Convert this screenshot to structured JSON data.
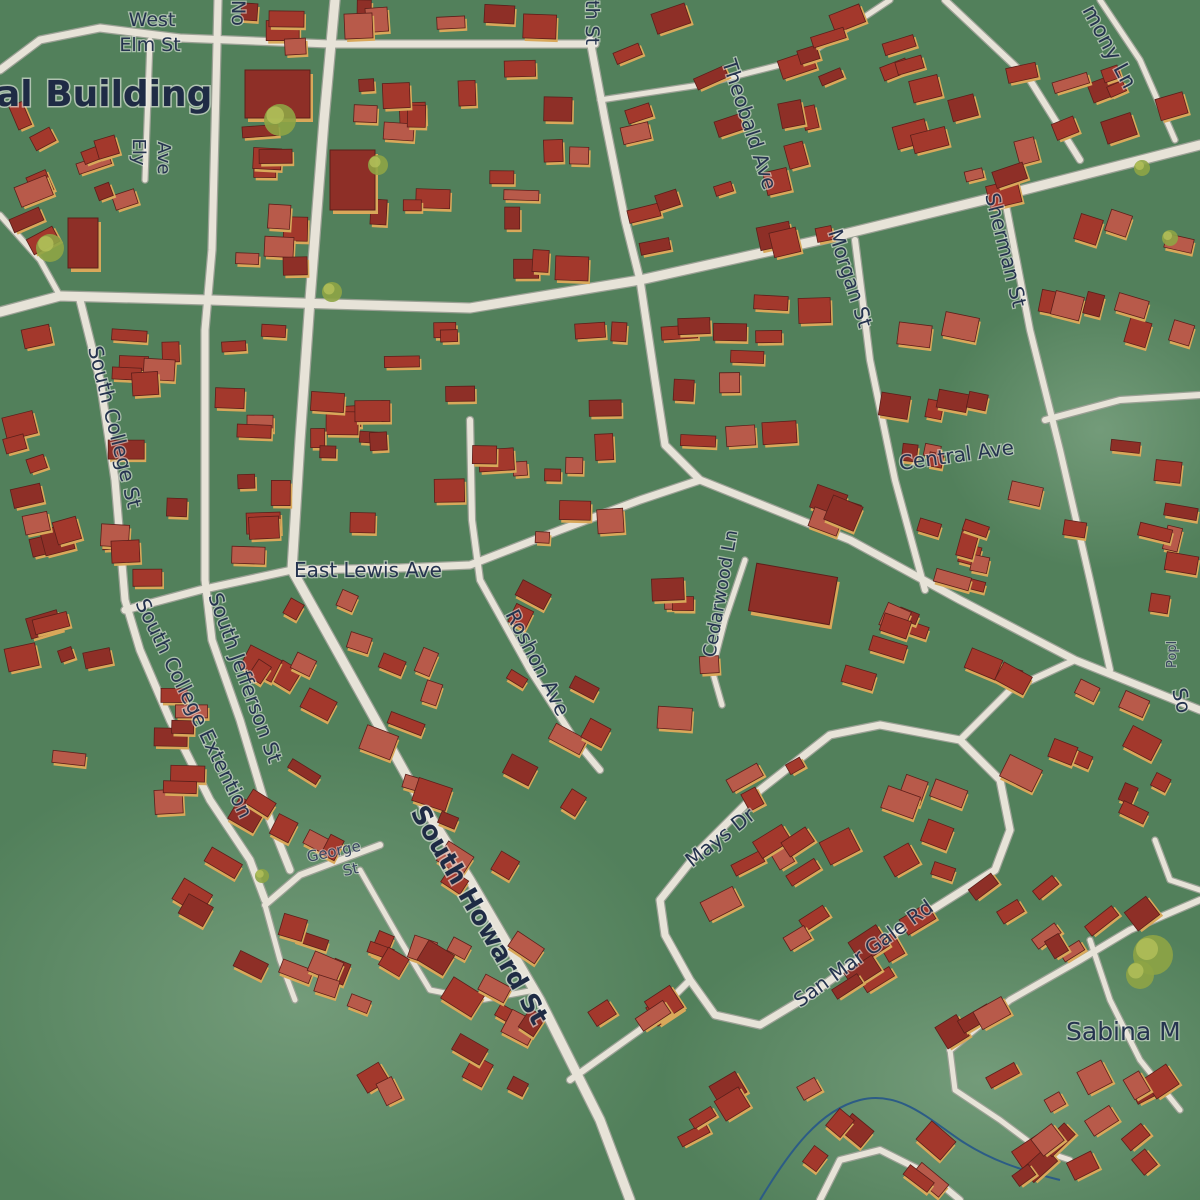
{
  "map": {
    "colors": {
      "ground": "#52805b",
      "ground_light": "#6f9a75",
      "road": "#e7e3d8",
      "road_edge": "#9aa094",
      "roof_dark": "#8e2f27",
      "roof": "#a3382c",
      "roof_light": "#b85a4a",
      "wall": "#d9a85a",
      "tree": "#8ea445",
      "stream": "#2c5c86",
      "label": "#25334f"
    },
    "labels": {
      "west_elm_st_1": "West",
      "west_elm_st_2": "Elm St",
      "municipal_building": "al Building",
      "ely_ave_1": "Ely",
      "ely_ave_2": "Ave",
      "north_st_partial": "No",
      "south_st_partial": "th St",
      "harmony_ln": "mony Ln",
      "theobald_ave": "Theobald Ave",
      "morgan_st": "Morgan St",
      "sherman_st": "Sherman St",
      "central_ave": "Central Ave",
      "south_college_st": "South College St",
      "east_lewis_ave": "East Lewis Ave",
      "cedarwood_ln": "Cedarwood Ln",
      "roshon_ave": "Roshon Ave",
      "south_college_extention": "South College Extention",
      "south_jefferson_st": "South Jefferson St",
      "george_st_1": "George",
      "george_st_2": "St",
      "south_howard_st": "South Howard St",
      "mays_dr": "Mays Dr",
      "san_mar_gale_rd": "San Mar Gale Rd",
      "sabina_partial": "Sabina M",
      "poplar_partial": "Popl",
      "so_partial": "So"
    }
  }
}
